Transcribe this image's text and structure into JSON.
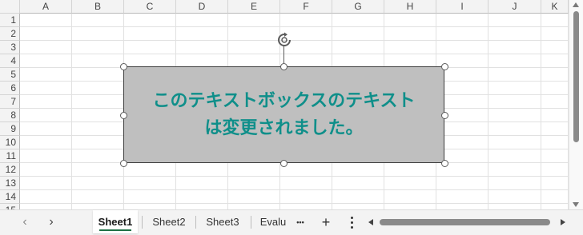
{
  "columns": [
    "A",
    "B",
    "C",
    "D",
    "E",
    "F",
    "G",
    "H",
    "I",
    "J",
    "K"
  ],
  "rows": [
    "1",
    "2",
    "3",
    "4",
    "5",
    "6",
    "7",
    "8",
    "9",
    "10",
    "11",
    "12",
    "13",
    "14",
    "15"
  ],
  "textbox": {
    "line1": "このテキストボックスのテキスト",
    "line2": "は変更されました。",
    "text_color": "#0f8f8a",
    "fill_color": "#bfbfbf"
  },
  "sheet_tabs": [
    {
      "label": "Sheet1",
      "active": true
    },
    {
      "label": "Sheet2",
      "active": false
    },
    {
      "label": "Sheet3",
      "active": false
    },
    {
      "label": "Evalu",
      "active": false
    }
  ],
  "tab_controls": {
    "prev_icon": "‹",
    "next_icon": "›",
    "more_tabs_icon": "•••",
    "add_sheet_icon": "+",
    "more_options_icon": "⋮"
  },
  "accent_color": "#1e7145"
}
